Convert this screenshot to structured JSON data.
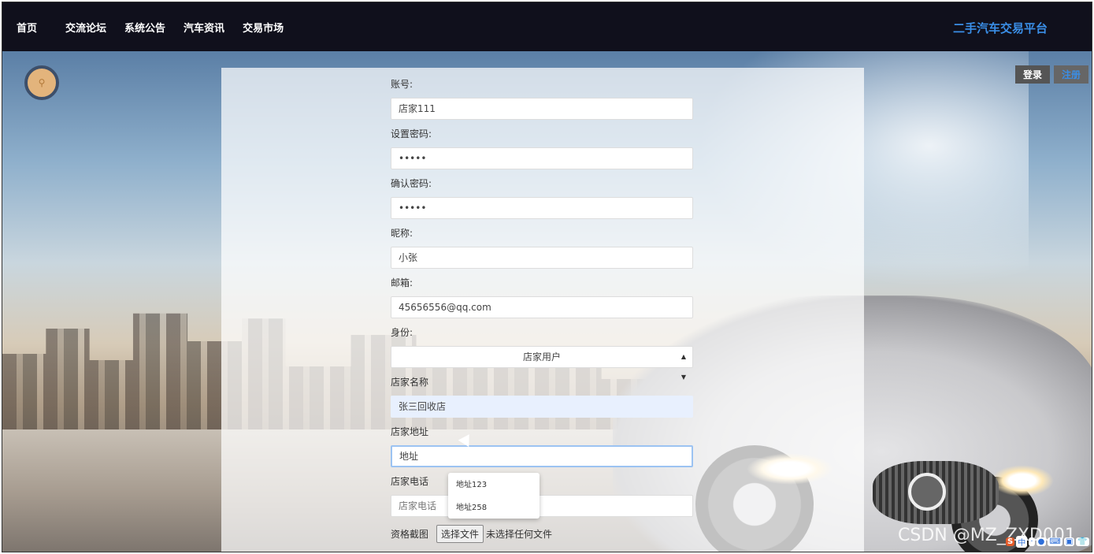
{
  "nav": {
    "items": [
      "首页",
      "交流论坛",
      "系统公告",
      "汽车资讯",
      "交易市场"
    ],
    "brand": "二手汽车交易平台"
  },
  "auth": {
    "login": "登录",
    "register": "注册"
  },
  "search": {
    "icon": "search-icon"
  },
  "form": {
    "account": {
      "label": "账号:",
      "value": "店家111"
    },
    "password": {
      "label": "设置密码:",
      "value": "•••••"
    },
    "confirm_password": {
      "label": "确认密码:",
      "value": "•••••"
    },
    "nickname": {
      "label": "昵称:",
      "value": "小张"
    },
    "email": {
      "label": "邮箱:",
      "value": "45656556@qq.com"
    },
    "role": {
      "label": "身份:",
      "value": "店家用户"
    },
    "shop_name": {
      "label": "店家名称",
      "value": "张三回收店"
    },
    "shop_address": {
      "label": "店家地址",
      "value": "地址"
    },
    "shop_phone": {
      "label": "店家电话",
      "placeholder": "店家电话"
    },
    "license": {
      "label": "资格截图",
      "button": "选择文件",
      "status": "未选择任何文件"
    }
  },
  "autocomplete": [
    "地址123",
    "地址258"
  ],
  "watermark": "CSDN @MZ_ZXD001",
  "ime": [
    "S",
    "中",
    "·",
    "●",
    "⌨",
    "▣",
    "👕"
  ],
  "colors": {
    "nav_bg": "#10101c",
    "brand": "#3a8ee6",
    "focus": "#9cc3f2",
    "autofill": "#e8f0fe"
  }
}
